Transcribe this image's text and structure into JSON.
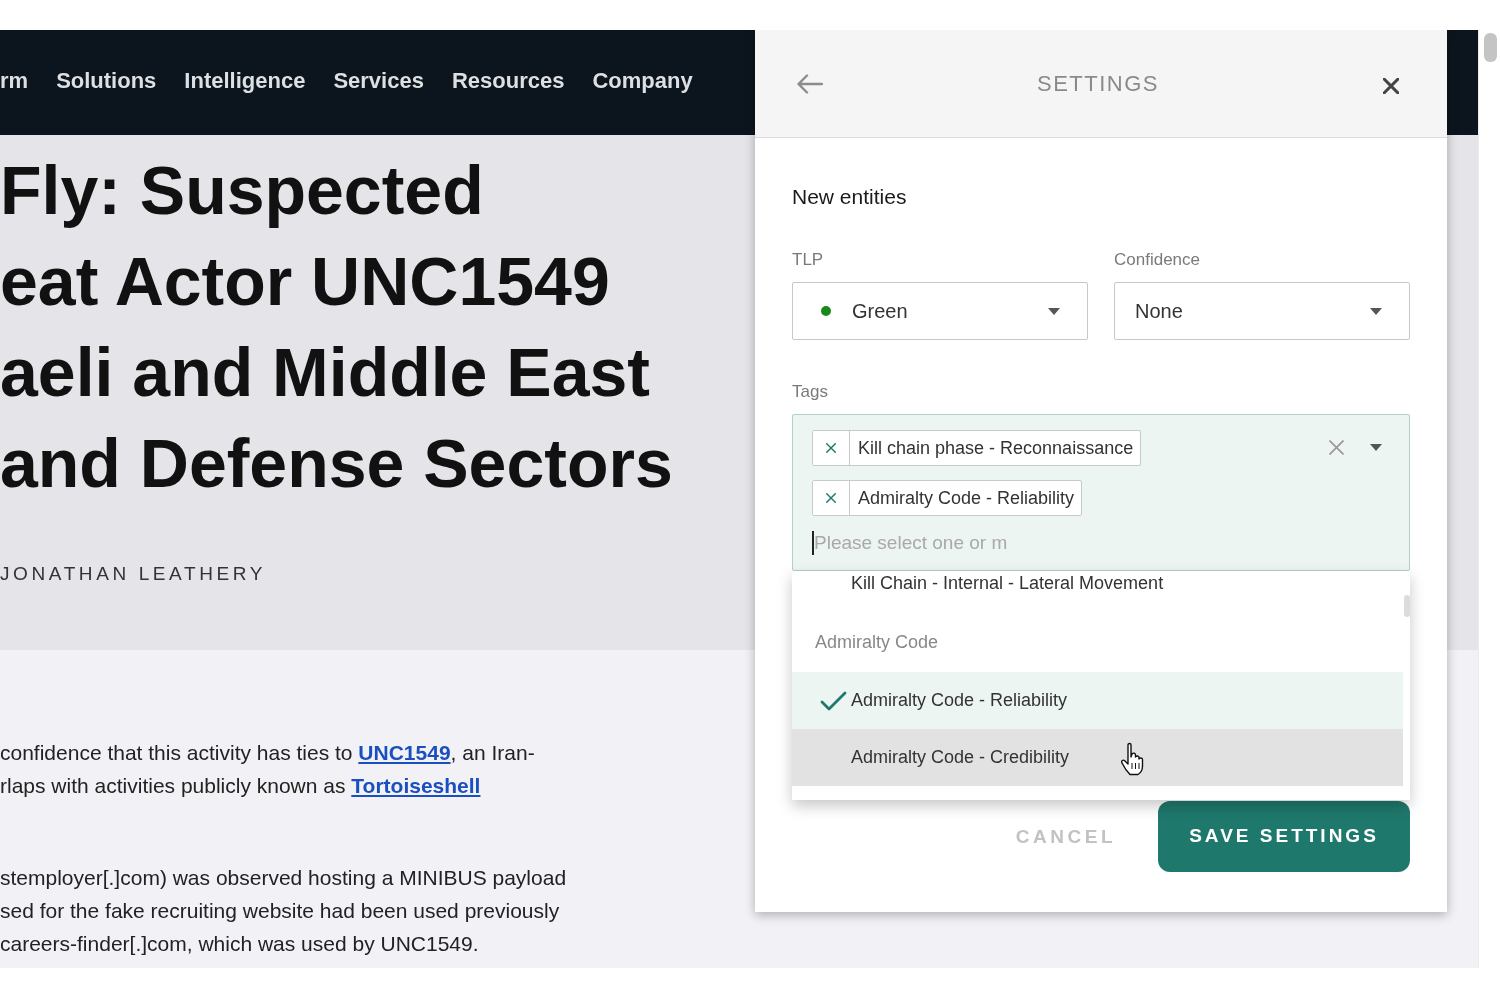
{
  "site": {
    "nav_links": [
      "rm",
      "Solutions",
      "Intelligence",
      "Services",
      "Resources",
      "Company"
    ],
    "headline_lines": [
      "Fly: Suspected",
      "eat Actor UNC1549",
      "aeli and Middle East",
      "and Defense Sectors"
    ],
    "author": "JONATHAN LEATHERY",
    "paragraphs": [
      {
        "lines": [
          [
            {
              "kind": "text",
              "text": "confidence that this activity has ties to "
            },
            {
              "kind": "link",
              "text": "UNC1549"
            },
            {
              "kind": "text",
              "text": ", an Iran-"
            }
          ],
          [
            {
              "kind": "text",
              "text": "rlaps with activities publicly known as "
            },
            {
              "kind": "link",
              "text": "Tortoiseshell"
            }
          ]
        ]
      },
      {
        "lines": [
          [
            {
              "kind": "text",
              "text": "stemployer[.]com) was observed hosting a MINIBUS payload"
            }
          ],
          [
            {
              "kind": "text",
              "text": "sed for the fake recruiting website had been used previously"
            }
          ],
          [
            {
              "kind": "text",
              "text": "careers-finder[.]com, which was used by UNC1549."
            }
          ]
        ]
      }
    ]
  },
  "settings_panel": {
    "title": "SETTINGS",
    "section_title": "New entities",
    "tlp": {
      "label": "TLP",
      "value": "Green",
      "color": "#178a17"
    },
    "confidence": {
      "label": "Confidence",
      "value": "None"
    },
    "tags": {
      "label": "Tags",
      "chips": [
        "Kill chain phase - Reconnaissance",
        "Admiralty Code - Reliability"
      ],
      "placeholder": "Please select one or m",
      "dropdown": {
        "groups": [
          {
            "options": [
              {
                "label": "Kill Chain - Internal - Lateral Movement",
                "selected": false,
                "hovered": false
              }
            ]
          },
          {
            "label": "Admiralty Code",
            "options": [
              {
                "label": "Admiralty Code - Reliability",
                "selected": true,
                "hovered": false
              },
              {
                "label": "Admiralty Code - Credibility",
                "selected": false,
                "hovered": true
              }
            ]
          }
        ]
      }
    },
    "buttons": {
      "cancel": "CANCEL",
      "save": "SAVE SETTINGS"
    }
  }
}
